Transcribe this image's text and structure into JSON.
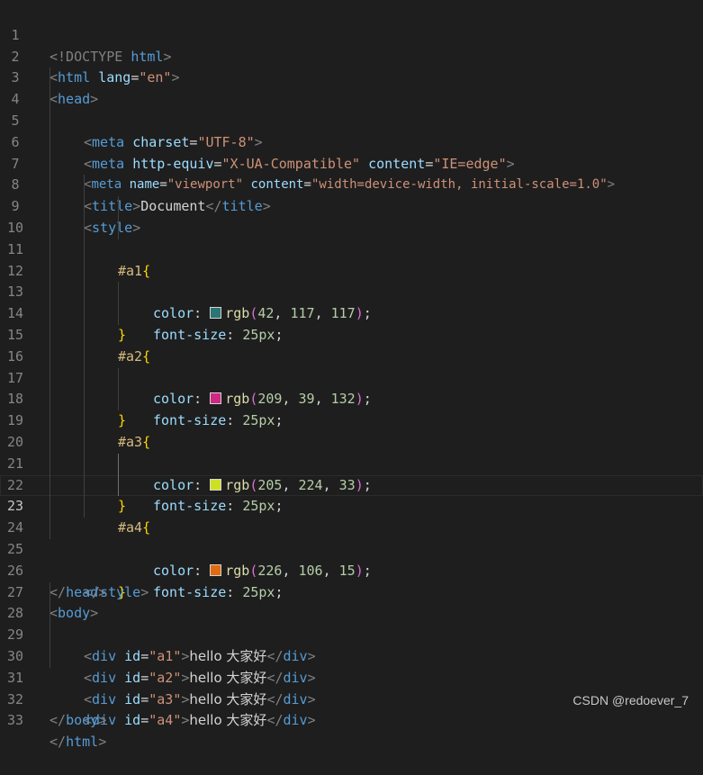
{
  "editor": {
    "line_numbers": [
      "1",
      "2",
      "3",
      "4",
      "5",
      "6",
      "7",
      "8",
      "9",
      "10",
      "11",
      "12",
      "13",
      "14",
      "15",
      "16",
      "17",
      "18",
      "19",
      "20",
      "21",
      "22",
      "23",
      "24",
      "25",
      "26",
      "27",
      "28",
      "29",
      "30",
      "31",
      "32",
      "33"
    ],
    "current_line": "23"
  },
  "code": {
    "doctype_open": "<!DOCTYPE",
    "doctype_name": "html",
    "lt": "<",
    "gt": ">",
    "lt_slash": "</",
    "eq": "=",
    "tag_html": "html",
    "tag_head": "head",
    "tag_meta": "meta",
    "tag_title": "title",
    "tag_style": "style",
    "tag_body": "body",
    "tag_div": "div",
    "attr_lang": "lang",
    "val_lang": "\"en\"",
    "attr_charset": "charset",
    "val_charset": "\"UTF-8\"",
    "attr_http_equiv": "http-equiv",
    "val_http_equiv": "\"X-UA-Compatible\"",
    "attr_content": "content",
    "val_ie_edge": "\"IE=edge\"",
    "attr_name": "name",
    "val_viewport": "\"viewport\"",
    "val_viewport_content": "\"width=device-width, initial-scale=1.0\"",
    "title_text": "Document",
    "brace_open": "{",
    "brace_close": "}",
    "prop_color": "color",
    "prop_font_size": "font-size",
    "colon": ": ",
    "semicolon": ";",
    "rgb": "rgb",
    "paren_open": "(",
    "paren_close": ")",
    "comma": ", ",
    "font_size_value": "25px",
    "attr_id": "id",
    "div_text": "hello 大家好",
    "rules": [
      {
        "selector": "#a1",
        "r": "42",
        "g": "117",
        "b": "117",
        "swatch": "#2a7575"
      },
      {
        "selector": "#a2",
        "r": "209",
        "g": "39",
        "b": "132",
        "swatch": "#d12784"
      },
      {
        "selector": "#a3",
        "r": "205",
        "g": "224",
        "b": "33",
        "swatch": "#cde021"
      },
      {
        "selector": "#a4",
        "r": "226",
        "g": "106",
        "b": "15",
        "swatch": "#e26a0f"
      }
    ],
    "div_ids": [
      "\"a1\"",
      "\"a2\"",
      "\"a3\"",
      "\"a4\""
    ]
  },
  "watermark": "CSDN @redoever_7"
}
